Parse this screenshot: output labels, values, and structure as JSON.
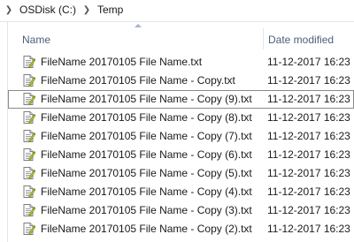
{
  "breadcrumb": {
    "items": [
      {
        "label": "OSDisk (C:)"
      },
      {
        "label": "Temp"
      }
    ]
  },
  "columns": {
    "name": "Name",
    "date_modified": "Date modified"
  },
  "files": [
    {
      "name": "FileName 20170105 File Name.txt",
      "date": "11-12-2017 16:23"
    },
    {
      "name": "FileName 20170105 File Name - Copy.txt",
      "date": "11-12-2017 16:23"
    },
    {
      "name": "FileName 20170105 File Name - Copy (9).txt",
      "date": "11-12-2017 16:23"
    },
    {
      "name": "FileName 20170105 File Name - Copy (8).txt",
      "date": "11-12-2017 16:23"
    },
    {
      "name": "FileName 20170105 File Name - Copy (7).txt",
      "date": "11-12-2017 16:23"
    },
    {
      "name": "FileName 20170105 File Name - Copy (6).txt",
      "date": "11-12-2017 16:23"
    },
    {
      "name": "FileName 20170105 File Name - Copy (5).txt",
      "date": "11-12-2017 16:23"
    },
    {
      "name": "FileName 20170105 File Name - Copy (4).txt",
      "date": "11-12-2017 16:23"
    },
    {
      "name": "FileName 20170105 File Name - Copy (3).txt",
      "date": "11-12-2017 16:23"
    },
    {
      "name": "FileName 20170105 File Name - Copy (2).txt",
      "date": "11-12-2017 16:23"
    }
  ],
  "focused_index": 2,
  "icons": {
    "chevron": "chevron-right-icon",
    "file": "text-file-icon",
    "sort": "sort-up-icon"
  },
  "colors": {
    "header_text": "#4c607a",
    "focus_border": "#8a8a8a"
  }
}
